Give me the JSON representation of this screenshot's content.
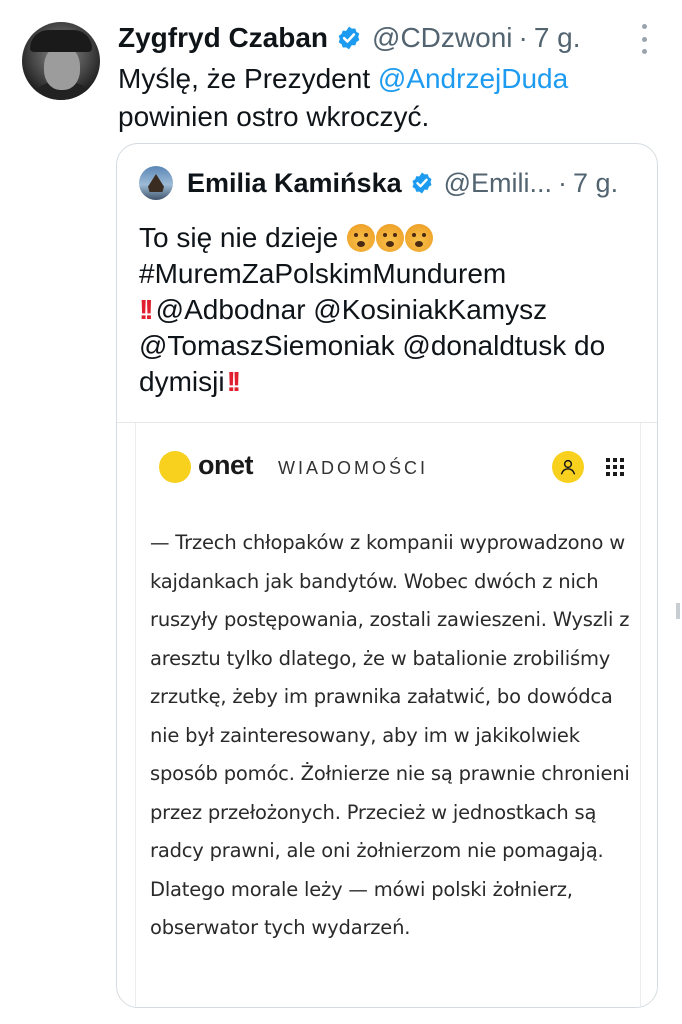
{
  "tweet": {
    "author_name": "Zygfryd Czaban",
    "author_handle": "@CDzwoni",
    "separator": "·",
    "time": "7 g.",
    "text_before": "Myślę, że Prezydent ",
    "mention": "@AndrzejDuda",
    "text_after": " powinien ostro wkroczyć."
  },
  "quoted_tweet": {
    "author_name": "Emilia Kamińska",
    "author_handle": "@Emili...",
    "separator": "·",
    "time": "7 g.",
    "line1": "To się nie dzieje",
    "hashtag": "#MuremZaPolskimMundurem",
    "mentions_line": "@Adbodnar @KosiniakKamysz @TomaszSiemoniak @donaldtusk do dymisji",
    "bang": "!!"
  },
  "media_card": {
    "logo": "onet",
    "section": "WIADOMOŚCI",
    "article_text": "— Trzech chłopaków z kompanii wyprowadzono w kajdankach jak bandytów. Wobec dwóch z nich ruszyły postępowania, zostali zawieszeni. Wyszli z aresztu tylko dlatego, że w batalionie zrobiliśmy zrzutkę, żeby im prawnika załatwić, bo dowódca nie był zainteresowany, aby im w jakikolwiek sposób pomóc. Żołnierze nie są prawnie chronieni przez przełożonych. Przecież w jednostkach są radcy prawni, ale oni żołnierzom nie pomagają. Dlatego morale leży — mówi polski żołnierz, obserwator tych wydarzeń."
  },
  "colors": {
    "link": "#1d9bf0",
    "verified": "#1d9bf0",
    "onet_yellow": "#f7d11e",
    "muted": "#536471"
  },
  "icons": [
    "verified-badge-icon",
    "more-options-icon",
    "user-icon",
    "apps-grid-icon",
    "astonished-emoji-icon",
    "double-exclamation-icon"
  ]
}
